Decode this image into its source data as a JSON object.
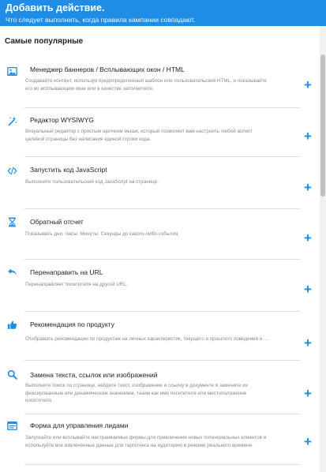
{
  "header": {
    "title": "Добавить действие.",
    "subtitle": "Что следует выполнить, когда правила кампании совпадают."
  },
  "section": {
    "title": "Самые популярные"
  },
  "items": [
    {
      "icon": "image-icon",
      "title": "Менеджер баннеров / Всплывающих окон / HTML",
      "description": "Создавайте контент, используя предопределенный шаблон или пользовательский HTML, и показывайте его во всплывающем окне или в качестве заполнителя.",
      "plus": "+"
    },
    {
      "icon": "magic-wand-icon",
      "title": "Редактор WYSIWYG",
      "description": "Визуальный редактор с простым щелчком мыши, который позволяет вам настроить любой аспект целевой страницы без написания единой строки кода.",
      "plus": "+"
    },
    {
      "icon": "code-icon",
      "title": "Запустить код JavaScript",
      "description": "Выполните пользовательский код JavaScript на странице.",
      "plus": "+"
    },
    {
      "icon": "hourglass-icon",
      "title": "Обратный отсчет",
      "description": "Показывать дни: Часы: Минуты: Секунды до какого-либо события.",
      "plus": "+"
    },
    {
      "icon": "reply-arrow-icon",
      "title": "Перенаправить на URL",
      "description": "Перенаправляет посетителя на другой URL.",
      "plus": "+"
    },
    {
      "icon": "thumbs-up-icon",
      "title": "Рекомендация по продукту",
      "description": "Отображать рекомендации по продуктам на личных характеристик, текущего и прошлого поведения и ...",
      "plus": "+"
    },
    {
      "icon": "search-icon",
      "title": "Замена текста, ссылок или изображений",
      "description": "Выполните поиск по странице, найдите текст, изображение и ссылку в документе и замените их фиксированным или динамическим значением, таким как имя посетителя или местоположение посетителя.",
      "plus": "+"
    },
    {
      "icon": "form-icon",
      "title": "Форма для управления лидами",
      "description": "Запускайте или всплывайте настраиваемые формы для привлечения новых потенциальных клиентов и используйте все извлеченные данные для таргетинга на аудиторию в режиме реального времени.",
      "plus": "+"
    }
  ],
  "colors": {
    "accent": "#1f8ce6",
    "header_bg": "#1f8ce6",
    "divider": "#dcdcdc",
    "desc_text": "#888888"
  }
}
